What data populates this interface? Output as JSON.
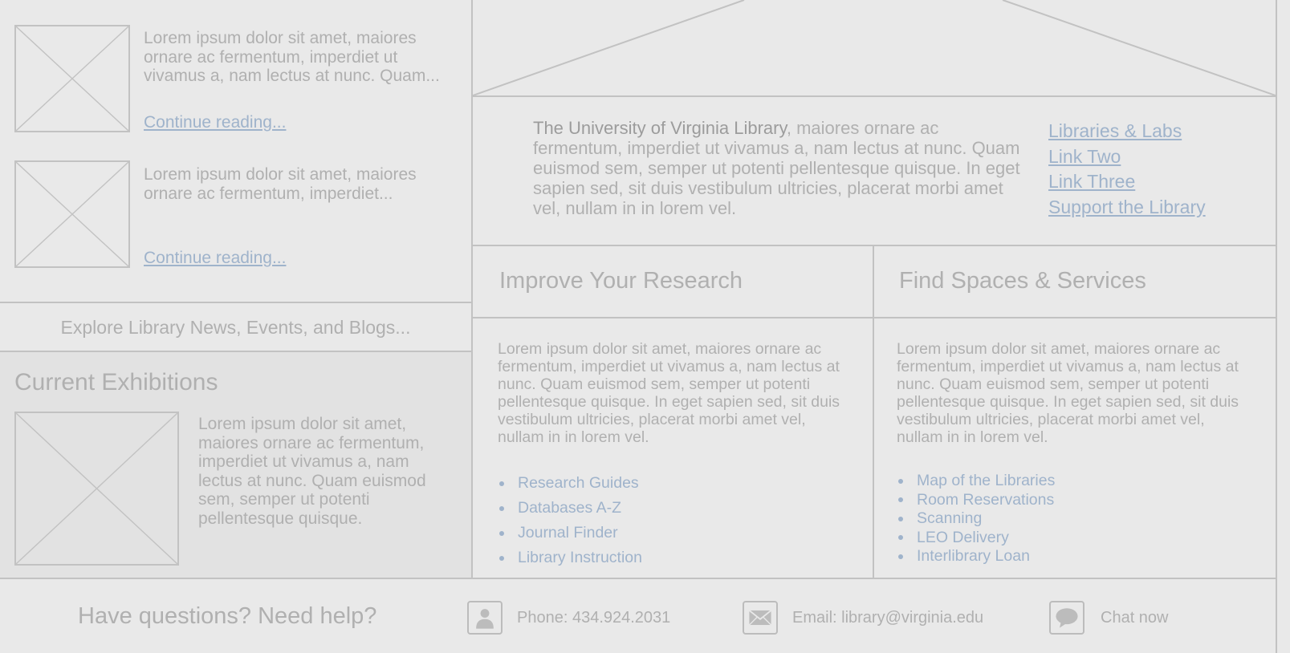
{
  "news": {
    "items": [
      {
        "excerpt": "Lorem ipsum dolor sit amet, maiores ornare ac fermentum, imperdiet ut vivamus a, nam lectus at nunc. Quam...",
        "link": "Continue reading..."
      },
      {
        "excerpt": "Lorem ipsum dolor sit amet, maiores ornare ac fermentum, imperdiet...",
        "link": "Continue reading..."
      }
    ],
    "explore": "Explore Library News, Events, and Blogs..."
  },
  "exhibitions": {
    "title": "Current Exhibitions",
    "text": "Lorem ipsum dolor sit amet, maiores ornare ac fermentum, imperdiet ut vivamus a, nam lectus at nunc. Quam euismod sem, semper ut potenti pellentesque quisque."
  },
  "about": {
    "name": "The University of Virginia Library",
    "text": ", maiores ornare ac fermentum, imperdiet ut vivamus a, nam lectus at nunc. Quam euismod sem, semper ut potenti pellentesque quisque. In eget sapien sed, sit duis vestibulum ultricies, placerat morbi amet vel, nullam in in lorem vel.",
    "links": [
      "Libraries & Labs",
      "Link Two",
      "Link Three",
      "Support the Library"
    ]
  },
  "research": {
    "title": "Improve Your Research",
    "text": "Lorem ipsum dolor sit amet, maiores ornare ac fermentum, imperdiet ut vivamus a, nam lectus at nunc. Quam euismod sem, semper ut potenti pellentesque quisque. In eget sapien sed, sit duis vestibulum ultricies, placerat morbi amet vel, nullam in in lorem vel.",
    "links": [
      "Research Guides",
      "Databases A-Z",
      "Journal Finder",
      "Library Instruction"
    ]
  },
  "spaces": {
    "title": "Find Spaces & Services",
    "text": "Lorem ipsum dolor sit amet, maiores ornare ac fermentum, imperdiet ut vivamus a, nam lectus at nunc. Quam euismod sem, semper ut potenti pellentesque quisque. In eget sapien sed, sit duis vestibulum ultricies, placerat morbi amet vel, nullam in in lorem vel.",
    "links": [
      "Map of the Libraries",
      "Room Reservations",
      "Scanning",
      "LEO Delivery",
      "Interlibrary Loan"
    ]
  },
  "footer": {
    "help": "Have questions? Need help?",
    "phone": "Phone: 434.924.2031",
    "email": "Email: library@virginia.edu",
    "chat": "Chat now",
    "icons": [
      "person-icon",
      "envelope-icon",
      "chat-bubble-icon"
    ]
  },
  "colors": {
    "background": "#e9e9e9",
    "panel": "#e2e2e2",
    "border": "#c2c2c2",
    "text": "#b0b0b0",
    "link": "#9fb3cb"
  }
}
